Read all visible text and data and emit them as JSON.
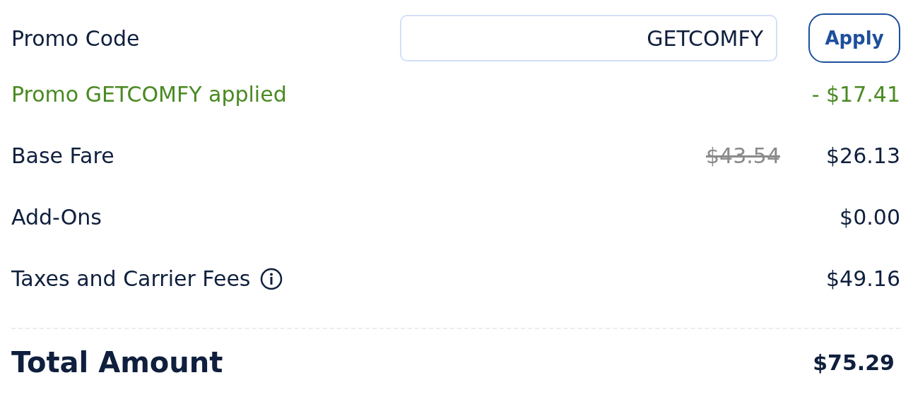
{
  "promo": {
    "label": "Promo Code",
    "value": "GETCOMFY",
    "button": "Apply"
  },
  "applied": {
    "label": "Promo GETCOMFY applied",
    "amount": "- $17.41"
  },
  "lines": [
    {
      "label": "Base Fare",
      "original": "$43.54",
      "amount": "$26.13",
      "info": false
    },
    {
      "label": "Add-Ons",
      "amount": "$0.00",
      "info": false
    },
    {
      "label": "Taxes and Carrier Fees",
      "amount": "$49.16",
      "info": true
    }
  ],
  "total": {
    "label": "Total Amount",
    "amount": "$75.29"
  }
}
